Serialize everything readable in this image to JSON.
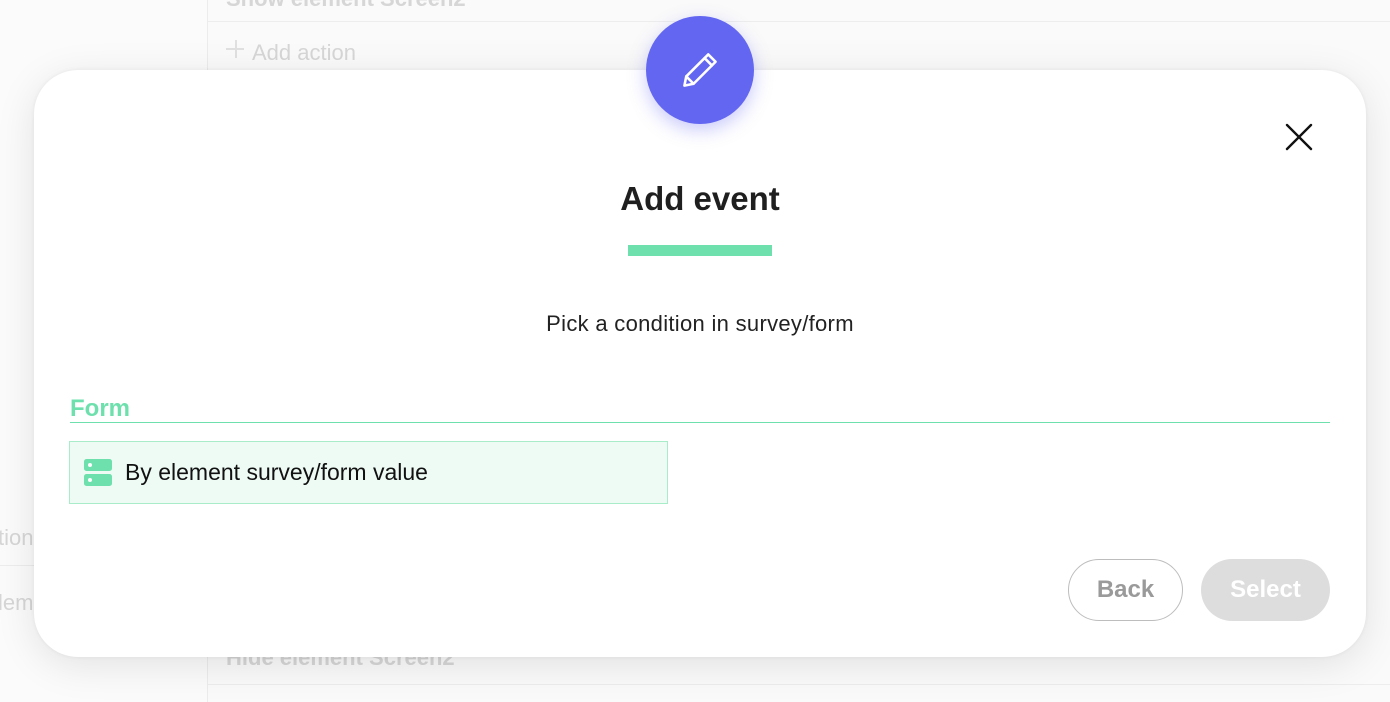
{
  "background": {
    "row_top_text": "Show element Screen2",
    "add_action_label": "Add action",
    "left_frag_1": "tion",
    "left_frag_2": "lem",
    "row_bottom_text": "Hide element Screen2"
  },
  "modal": {
    "badge_icon": "pencil-icon",
    "close_icon": "close-icon",
    "title": "Add event",
    "subtitle": "Pick a condition in survey/form",
    "section": {
      "heading": "Form",
      "options": [
        {
          "icon": "server-list-icon",
          "label": "By element survey/form value"
        }
      ]
    },
    "buttons": {
      "back": "Back",
      "select": "Select"
    }
  },
  "colors": {
    "accent_purple": "#6366f1",
    "accent_green": "#6ee0ad",
    "option_bg": "#eefbf5",
    "select_disabled": "#dddddd"
  }
}
